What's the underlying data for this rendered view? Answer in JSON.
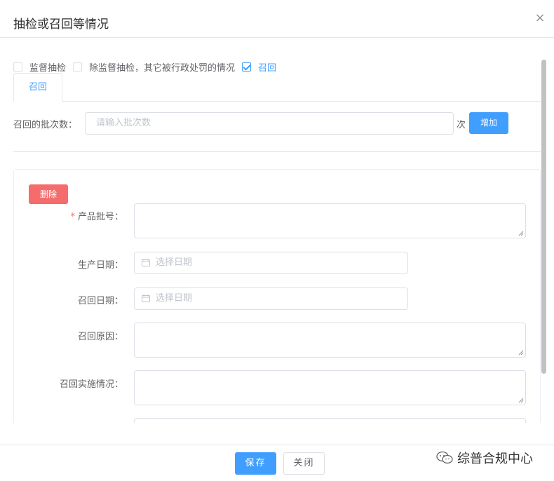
{
  "dialog": {
    "title": "抽检或召回等情况",
    "close_symbol": "×"
  },
  "checkboxes": [
    {
      "label": "监督抽检",
      "checked": false
    },
    {
      "label": "除监督抽检，其它被行政处罚的情况",
      "checked": false
    },
    {
      "label": "召回",
      "checked": true
    }
  ],
  "tabs": [
    {
      "label": "召回",
      "active": true
    }
  ],
  "batch": {
    "label": "召回的批次数：",
    "placeholder": "请输入批次数",
    "unit": "次",
    "add_label": "增加"
  },
  "record": {
    "delete_label": "删除",
    "fields": {
      "batch_no": {
        "label": "产品批号：",
        "required": true
      },
      "production_date": {
        "label": "生产日期：",
        "placeholder": "选择日期"
      },
      "recall_date": {
        "label": "召回日期：",
        "placeholder": "选择日期"
      },
      "recall_reason": {
        "label": "召回原因："
      },
      "recall_implementation": {
        "label": "召回实施情况："
      }
    }
  },
  "footer": {
    "save_label": "保存",
    "close_label": "关闭"
  },
  "watermark": {
    "text": "综普合规中心",
    "icon": "wechat-icon"
  },
  "colors": {
    "primary": "#409eff",
    "danger": "#f56c6c",
    "border": "#dcdfe6",
    "placeholder": "#c0c4cc",
    "text": "#606266"
  }
}
